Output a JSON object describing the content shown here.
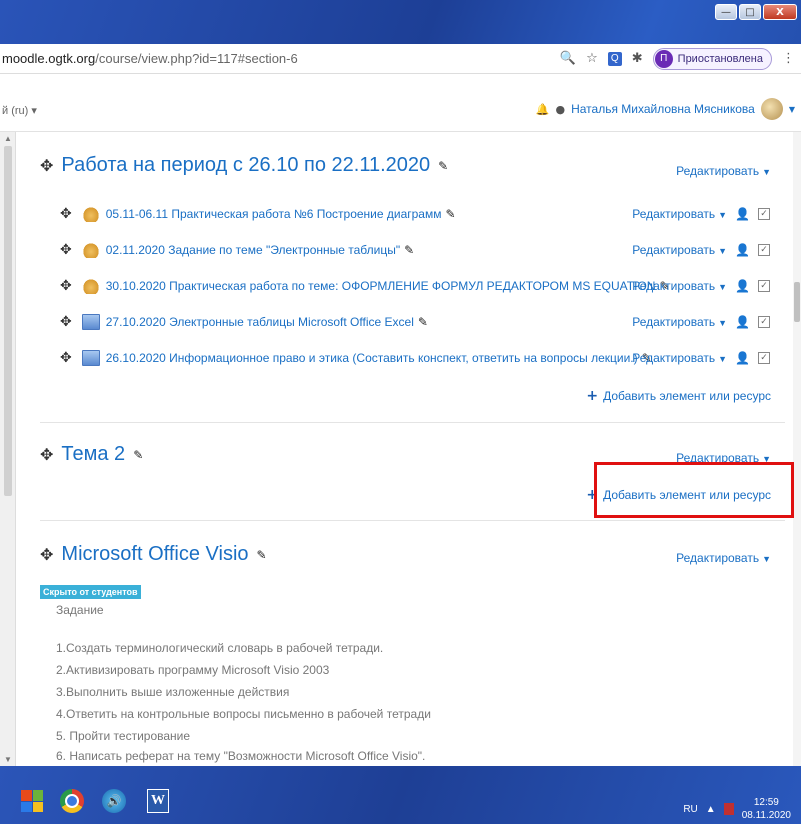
{
  "browser": {
    "url_host": "moodle.ogtk.org",
    "url_path": "/course/view.php?id=117#section-6",
    "profile_initial": "П",
    "profile_label": "Приостановлена",
    "ext_q": "Q"
  },
  "window": {
    "minimize": "—",
    "maximize": "□",
    "close": "X"
  },
  "moodle": {
    "lang": "й (ru) ▾",
    "username": "Наталья Михайловна Мясникова"
  },
  "sections": [
    {
      "title": "Работа на период с 26.10 по 22.11.2020",
      "edit_label": "Редактировать",
      "activities": [
        {
          "name": "05.11-06.11 Практическая работа №6 Построение диаграмм",
          "icon": "assignment",
          "edit_label": "Редактировать"
        },
        {
          "name": "02.11.2020 Задание по теме \"Электронные таблицы\"",
          "icon": "assignment",
          "edit_label": "Редактировать"
        },
        {
          "name": "30.10.2020 Практическая работа по теме: ОФОРМЛЕНИЕ ФОРМУЛ РЕДАКТОРОМ MS EQUATION",
          "icon": "assignment",
          "edit_label": "Редактировать"
        },
        {
          "name": "27.10.2020 Электронные таблицы Microsoft Office Excel",
          "icon": "page",
          "edit_label": "Редактировать"
        },
        {
          "name": "26.10.2020 Информационное право и этика (Составить конспект, ответить на вопросы лекции.)",
          "icon": "page",
          "edit_label": "Редактировать"
        }
      ],
      "add_label": "Добавить элемент или ресурс"
    },
    {
      "title": "Тема 2",
      "edit_label": "Редактировать",
      "add_label": "Добавить элемент или ресурс"
    },
    {
      "title": "Microsoft Office Visio",
      "edit_label": "Редактировать",
      "hidden_badge": "Скрыто от студентов",
      "task_heading": "Задание",
      "lines": [
        "1.Создать терминологический  словарь в рабочей тетради.",
        "2.Активизировать программу Microsoft Visio 2003",
        "3.Выполнить выше изложенные действия",
        "4.Ответить на контрольные вопросы письменно в рабочей тетради",
        "5. Пройти тестирование",
        "6. Написать реферат на тему \"Возможности Microsoft Office Visio\"."
      ]
    }
  ],
  "taskbar": {
    "word_letter": "W",
    "lang": "RU",
    "time": "12:59",
    "date": "08.11.2020"
  },
  "icons": {
    "move": "✥",
    "pencil": "✎",
    "caret": "▼",
    "person": "👤",
    "check": "✓",
    "plus": "+",
    "search": "🔍",
    "star": "☆",
    "puzzle": "✱",
    "bell": "🔔",
    "chat": "●",
    "speaker": "🔊"
  },
  "colors": {
    "link": "#1a6fc4",
    "highlight_box": "#e01010",
    "hidden_badge": "#3ab0d8"
  }
}
